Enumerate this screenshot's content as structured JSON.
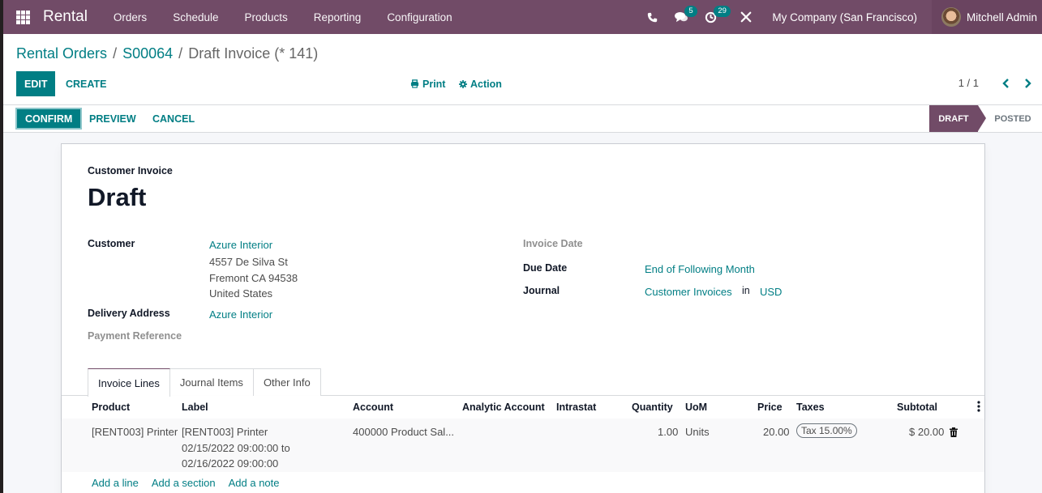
{
  "navbar": {
    "app_name": "Rental",
    "menu": [
      "Orders",
      "Schedule",
      "Products",
      "Reporting",
      "Configuration"
    ],
    "icons": {
      "phone": "phone-icon",
      "messages": "chat-icon",
      "activities": "clock-icon",
      "debug": "tools-icon"
    },
    "messages_badge": "5",
    "activities_badge": "29",
    "company": "My Company (San Francisco)",
    "user": "Mitchell Admin",
    "colors": {
      "bar": "#714b67",
      "badge": "#017e84"
    }
  },
  "breadcrumb": {
    "items": [
      "Rental Orders",
      "S00064"
    ],
    "current": "Draft Invoice (* 141)",
    "separator": "/"
  },
  "control": {
    "edit_label": "EDIT",
    "create_label": "CREATE",
    "print_label": "Print",
    "action_label": "Action",
    "pager": "1 / 1"
  },
  "statusbar": {
    "confirm_label": "CONFIRM",
    "preview_label": "PREVIEW",
    "cancel_label": "CANCEL",
    "stages": [
      "DRAFT",
      "POSTED"
    ],
    "active_stage": "DRAFT"
  },
  "form": {
    "subtitle": "Customer Invoice",
    "title": "Draft",
    "customer_label": "Customer",
    "customer_name": "Azure Interior",
    "customer_address": [
      "4557 De Silva St",
      "Fremont CA 94538",
      "United States"
    ],
    "delivery_label": "Delivery Address",
    "delivery_value": "Azure Interior",
    "payment_ref_label": "Payment Reference",
    "invoice_date_label": "Invoice Date",
    "due_date_label": "Due Date",
    "due_date_value": "End of Following Month",
    "journal_label": "Journal",
    "journal_value": "Customer Invoices",
    "journal_in": "in",
    "currency": "USD"
  },
  "tabs": [
    "Invoice Lines",
    "Journal Items",
    "Other Info"
  ],
  "active_tab": "Invoice Lines",
  "table": {
    "columns": [
      "Product",
      "Label",
      "Account",
      "Analytic Account",
      "Intrastat",
      "Quantity",
      "UoM",
      "Price",
      "Taxes",
      "Subtotal"
    ],
    "rows": [
      {
        "product": "[RENT003] Printer",
        "label": [
          "[RENT003] Printer",
          "02/15/2022 09:00:00 to",
          "02/16/2022 09:00:00"
        ],
        "account": "400000 Product Sal...",
        "analytic_account": "",
        "intrastat": "",
        "quantity": "1.00",
        "uom": "Units",
        "price": "20.00",
        "taxes": "Tax 15.00%",
        "subtotal": "$ 20.00"
      }
    ],
    "add_links": [
      "Add a line",
      "Add a section",
      "Add a note"
    ]
  }
}
